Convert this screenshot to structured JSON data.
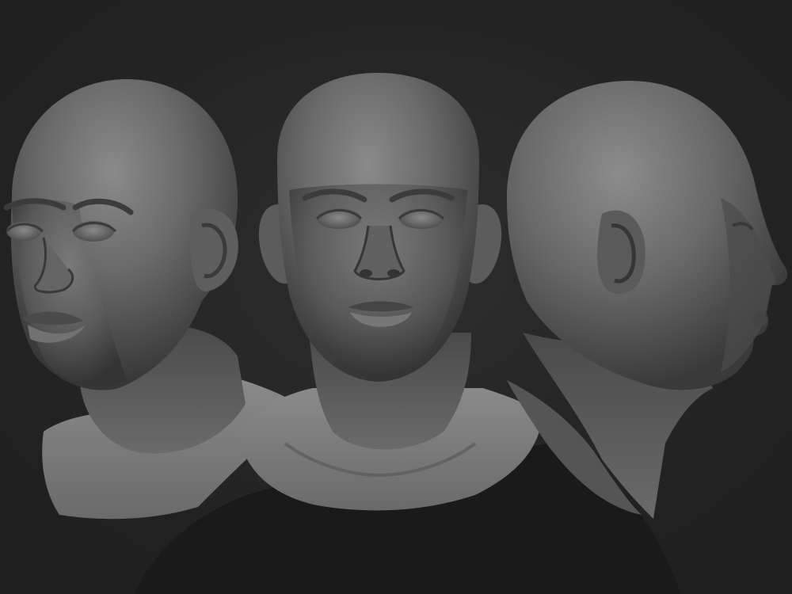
{
  "scene": {
    "background_color": "#262626",
    "material_color": "#6e6e6e",
    "views": [
      {
        "view": "three-quarter-left",
        "icon": "head-three-quarter-icon"
      },
      {
        "view": "front",
        "icon": "head-front-icon"
      },
      {
        "view": "profile-right",
        "icon": "head-profile-icon"
      }
    ]
  }
}
